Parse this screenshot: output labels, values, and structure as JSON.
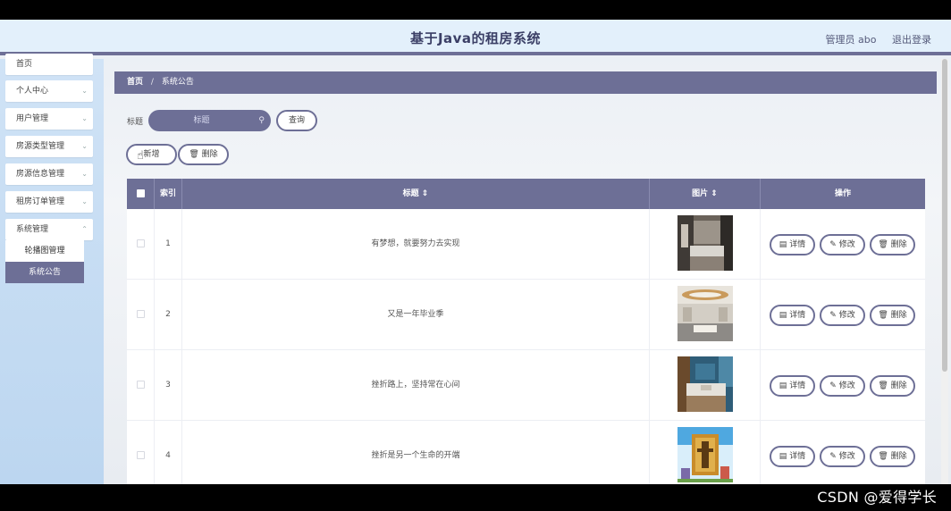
{
  "header": {
    "title": "基于Java的租房系统",
    "user": "管理员 abo",
    "logout": "退出登录"
  },
  "sidebar": {
    "items": [
      {
        "label": "首页",
        "has_arrow": false
      },
      {
        "label": "个人中心",
        "has_arrow": true
      },
      {
        "label": "用户管理",
        "has_arrow": true
      },
      {
        "label": "房源类型管理",
        "has_arrow": true
      },
      {
        "label": "房源信息管理",
        "has_arrow": true
      },
      {
        "label": "租房订单管理",
        "has_arrow": true
      },
      {
        "label": "系统管理",
        "has_arrow": true
      }
    ],
    "subitems": [
      {
        "label": "轮播图管理",
        "active": false
      },
      {
        "label": "系统公告",
        "active": true
      }
    ]
  },
  "breadcrumb": {
    "home": "首页",
    "separator": "/",
    "current": "系统公告"
  },
  "search": {
    "label": "标题",
    "placeholder": "标题",
    "query_label": "查询"
  },
  "toolbar": {
    "add_label": "新增",
    "delete_label": "删除"
  },
  "table": {
    "columns": {
      "index": "索引",
      "title": "标题 ⇕",
      "image": "图片 ⇕",
      "ops": "操作"
    },
    "rows": [
      {
        "index": "1",
        "title": "有梦想，就要努力去实现"
      },
      {
        "index": "2",
        "title": "又是一年毕业季"
      },
      {
        "index": "3",
        "title": "挫折路上，坚持常在心间"
      },
      {
        "index": "4",
        "title": "挫折是另一个生命的开端"
      }
    ],
    "actions": {
      "detail": "详情",
      "edit": "修改",
      "delete": "删除"
    }
  },
  "watermark": "CSDN @爱得学长",
  "colors": {
    "accent": "#6d6f96",
    "header_bg": "#e3f0fb",
    "sidebar_bg": "#c6dcf3"
  }
}
